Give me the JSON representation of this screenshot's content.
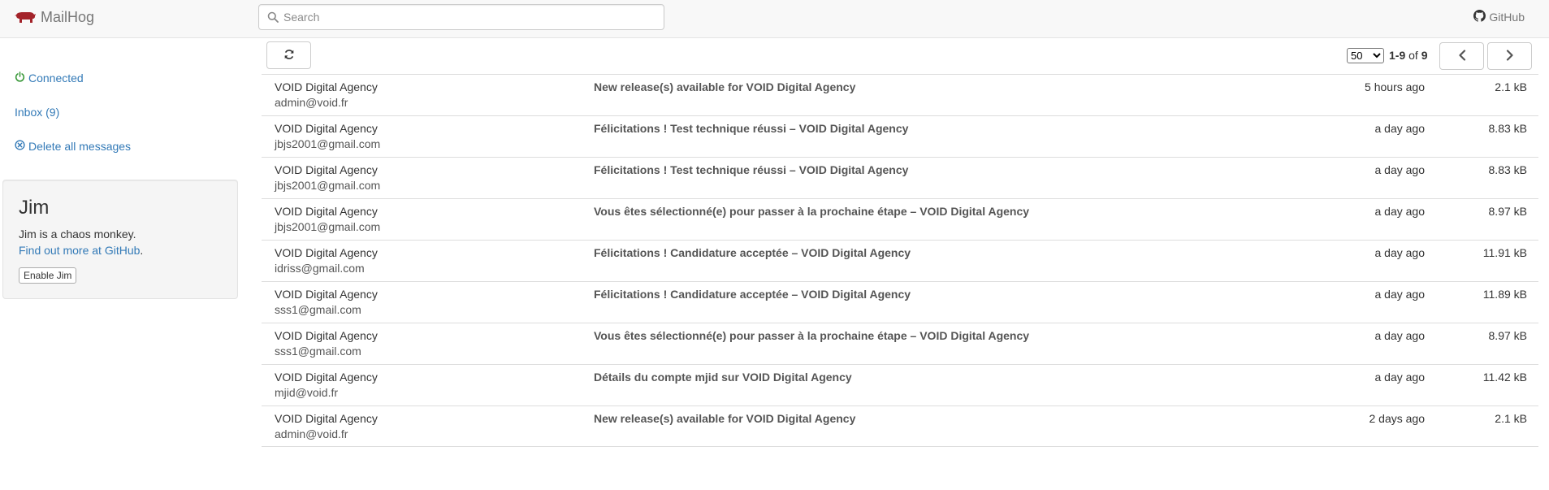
{
  "app": {
    "brand": "MailHog"
  },
  "search": {
    "placeholder": "Search"
  },
  "nav": {
    "github_label": "GitHub"
  },
  "sidebar": {
    "status": "Connected",
    "inbox": "Inbox (9)",
    "delete_all": "Delete all messages"
  },
  "jim": {
    "title": "Jim",
    "description": "Jim is a chaos monkey.",
    "more_link": "Find out more at GitHub",
    "more_suffix": ".",
    "enable_button": "Enable Jim"
  },
  "toolbar": {
    "per_page_selected": "50",
    "per_page_options": [
      "50"
    ],
    "range": "1-9",
    "of_label": "of",
    "total": "9"
  },
  "messages": [
    {
      "from": "VOID Digital Agency",
      "to": "admin@void.fr",
      "subject": "New release(s) available for VOID Digital Agency",
      "time": "5 hours ago",
      "size": "2.1 kB"
    },
    {
      "from": "VOID Digital Agency",
      "to": "jbjs2001@gmail.com",
      "subject": "Félicitations ! Test technique réussi – VOID Digital Agency",
      "time": "a day ago",
      "size": "8.83 kB"
    },
    {
      "from": "VOID Digital Agency",
      "to": "jbjs2001@gmail.com",
      "subject": "Félicitations ! Test technique réussi – VOID Digital Agency",
      "time": "a day ago",
      "size": "8.83 kB"
    },
    {
      "from": "VOID Digital Agency",
      "to": "jbjs2001@gmail.com",
      "subject": "Vous êtes sélectionné(e) pour passer à la prochaine étape – VOID Digital Agency",
      "time": "a day ago",
      "size": "8.97 kB"
    },
    {
      "from": "VOID Digital Agency",
      "to": "idriss@gmail.com",
      "subject": "Félicitations ! Candidature acceptée – VOID Digital Agency",
      "time": "a day ago",
      "size": "11.91 kB"
    },
    {
      "from": "VOID Digital Agency",
      "to": "sss1@gmail.com",
      "subject": "Félicitations ! Candidature acceptée – VOID Digital Agency",
      "time": "a day ago",
      "size": "11.89 kB"
    },
    {
      "from": "VOID Digital Agency",
      "to": "sss1@gmail.com",
      "subject": "Vous êtes sélectionné(e) pour passer à la prochaine étape – VOID Digital Agency",
      "time": "a day ago",
      "size": "8.97 kB"
    },
    {
      "from": "VOID Digital Agency",
      "to": "mjid@void.fr",
      "subject": "Détails du compte mjid sur VOID Digital Agency",
      "time": "a day ago",
      "size": "11.42 kB"
    },
    {
      "from": "VOID Digital Agency",
      "to": "admin@void.fr",
      "subject": "New release(s) available for VOID Digital Agency",
      "time": "2 days ago",
      "size": "2.1 kB"
    }
  ],
  "colors": {
    "brand_icon": "#a3232a",
    "link": "#337ab7",
    "connected": "#3c9a3c",
    "navbar_bg": "#f8f8f8"
  },
  "icons": {
    "brand": "pig-logo-icon",
    "search": "search-icon",
    "github": "github-icon",
    "connected": "power-icon",
    "delete": "close-circle-icon",
    "refresh": "refresh-icon",
    "prev": "chevron-left-icon",
    "next": "chevron-right-icon"
  }
}
